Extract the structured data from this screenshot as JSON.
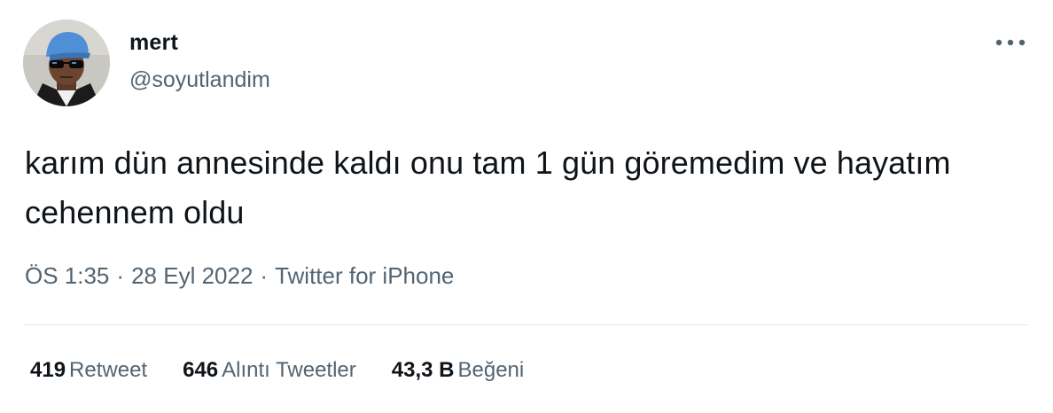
{
  "author": {
    "display_name": "mert",
    "handle": "@soyutlandim",
    "avatar_icon": "avatar-icon"
  },
  "more_icon": "more-horizontal-icon",
  "tweet": {
    "text": "karım dün annesinde kaldı onu tam 1 gün göremedim ve hayatım cehennem oldu"
  },
  "meta": {
    "time": "ÖS 1:35",
    "separator": "·",
    "date": "28 Eyl 2022",
    "source": "Twitter for iPhone"
  },
  "stats": {
    "retweets": {
      "count": "419",
      "label": "Retweet"
    },
    "quotes": {
      "count": "646",
      "label": "Alıntı Tweetler"
    },
    "likes": {
      "count": "43,3 B",
      "label": "Beğeni"
    }
  },
  "colors": {
    "primary_text": "#0f1419",
    "secondary_text": "#536471",
    "divider": "#e5e9ec",
    "background": "#ffffff"
  }
}
